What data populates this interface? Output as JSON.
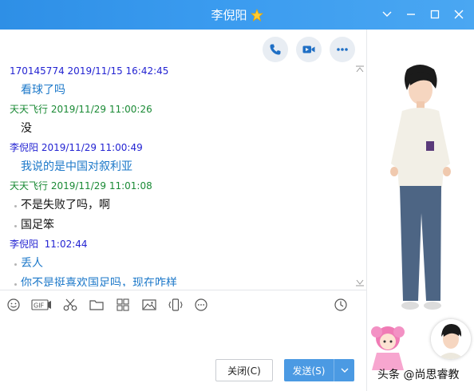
{
  "window": {
    "title": "李倪阳",
    "title_badge": "star-icon"
  },
  "call_actions": [
    {
      "name": "phone-icon"
    },
    {
      "name": "video-icon"
    },
    {
      "name": "more-icon"
    }
  ],
  "messages": [
    {
      "sender": "170145774",
      "time": "2019/11/15 16:42:45",
      "color": "#2323d2"
    },
    {
      "text": "看球了吗",
      "color": "#1c78c9"
    },
    {
      "sender": "天天飞行",
      "time": "2019/11/29 11:00:26",
      "color": "#1a8a35"
    },
    {
      "text": "没",
      "color": "#111111"
    },
    {
      "sender": "李倪阳",
      "time": "2019/11/29 11:00:49",
      "color": "#2323d2"
    },
    {
      "text": "我说的是中国对叙利亚",
      "color": "#1c78c9"
    },
    {
      "sender": "天天飞行",
      "time": "2019/11/29 11:01:08",
      "color": "#1a8a35"
    },
    {
      "text": "不是失败了吗，啊",
      "color": "#111111"
    },
    {
      "text": "国足笨",
      "color": "#111111"
    },
    {
      "sender": "李倪阳",
      "time": "11:02:44",
      "color": "#2323d2"
    },
    {
      "text": "丢人",
      "color": "#1c78c9"
    },
    {
      "text": "你不是挺喜欢国足吗，现在咋样",
      "color": "#1c78c9"
    }
  ],
  "toolbar": {
    "tools": [
      "emoji-icon",
      "gif-icon",
      "scissors-icon",
      "folder-icon",
      "image-grid-icon",
      "picture-icon",
      "shake-icon",
      "more-options-icon"
    ],
    "history": "clock-icon"
  },
  "buttons": {
    "close": "关闭(C)",
    "send": "发送(S)"
  },
  "watermark": "头条 @尚思睿教",
  "colors": {
    "titlebar": "#3a9bef",
    "send_button": "#4b9ae3"
  }
}
